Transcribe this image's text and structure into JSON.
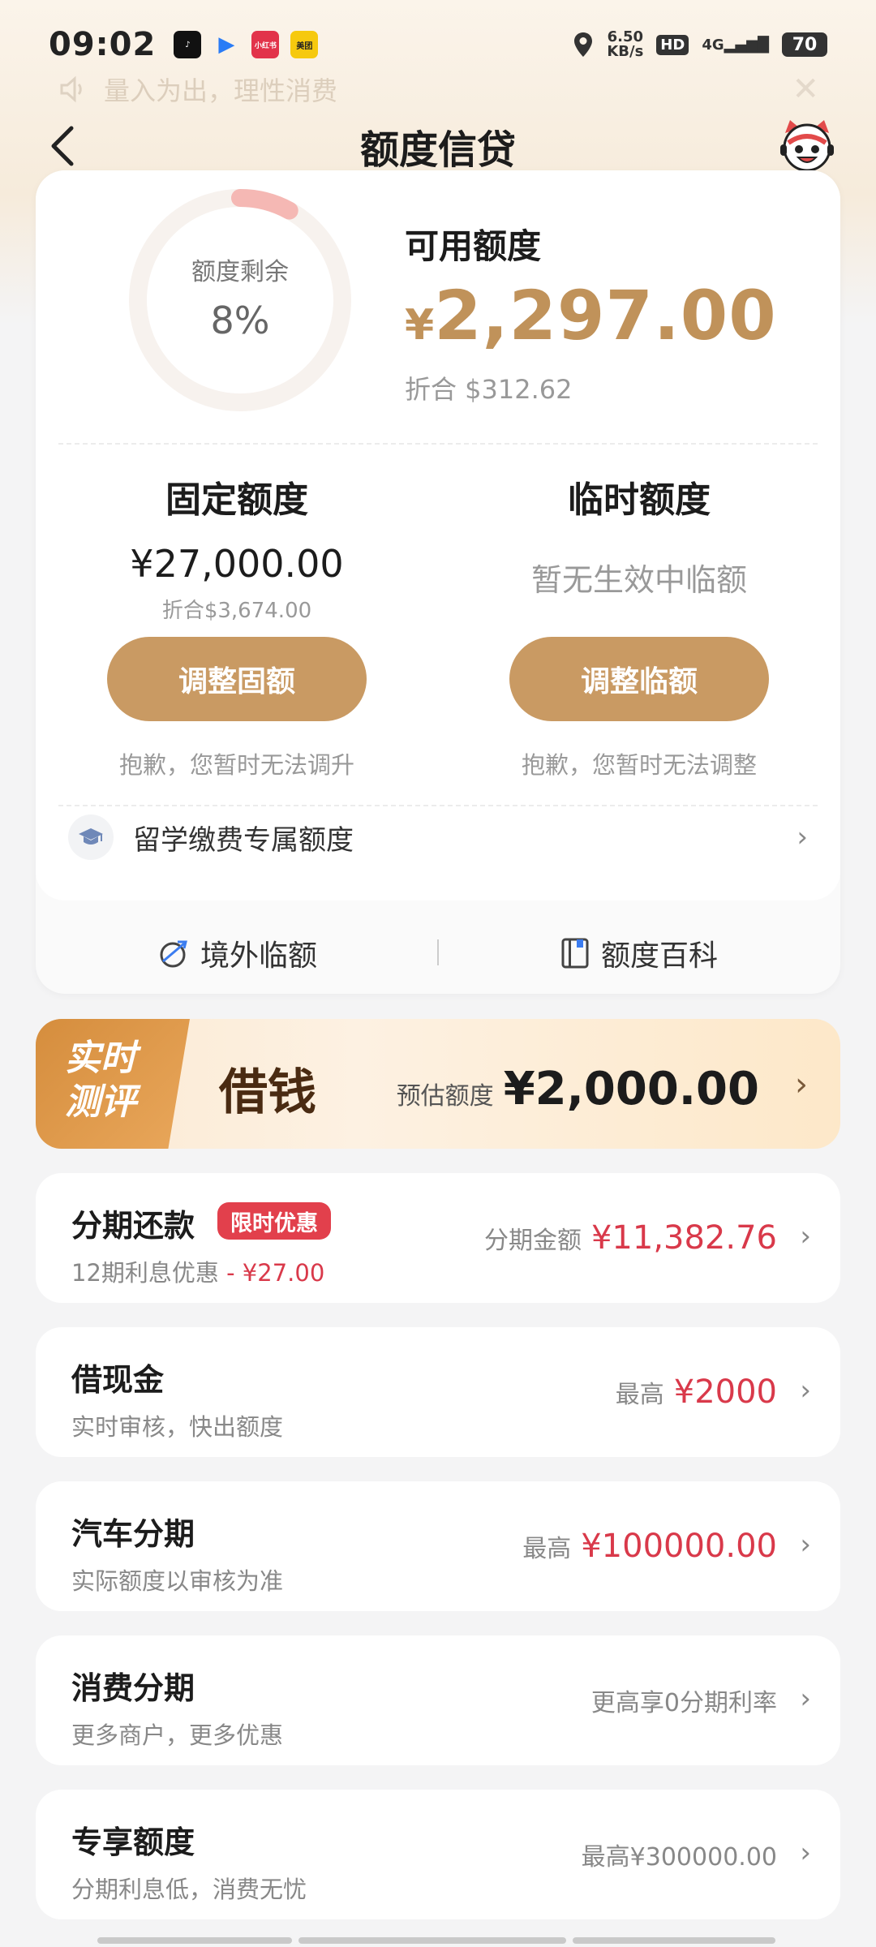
{
  "status_bar": {
    "time": "09:02",
    "apps": [
      {
        "name": "tiktok-icon",
        "text": "♪",
        "color": "#111111"
      },
      {
        "name": "video-app-icon",
        "text": "▶",
        "color": "#2a7cf6"
      },
      {
        "name": "xiaohongshu-icon",
        "text": "小红书",
        "color": "#e2334a"
      },
      {
        "name": "meituan-icon",
        "text": "美团",
        "color": "#f6c90e"
      }
    ],
    "net_speed_value": "6.50",
    "net_speed_unit": "KB/s",
    "hd": "HD",
    "signal": "4G",
    "battery": "70"
  },
  "notice": {
    "text": "量入为出，理性消费"
  },
  "header": {
    "title": "额度信贷"
  },
  "credit": {
    "ring_label": "额度剩余",
    "ring_percent_text": "8%",
    "ring_fraction": 0.08,
    "available_label": "可用额度",
    "currency_symbol": "¥",
    "available_amount": "2,297.00",
    "available_usd": "折合  $312.62",
    "fixed": {
      "title": "固定额度",
      "amount": "¥27,000.00",
      "usd": "折合$3,674.00",
      "button": "调整固额",
      "note": "抱歉，您暂时无法调升"
    },
    "temp": {
      "title": "临时额度",
      "status": "暂无生效中临额",
      "button": "调整临额",
      "note": "抱歉，您暂时无法调整"
    },
    "study": {
      "label": "留学缴费专属额度"
    },
    "links": [
      {
        "label": "境外临额",
        "icon": "plane-globe-icon"
      },
      {
        "label": "额度百科",
        "icon": "book-icon"
      }
    ]
  },
  "loan_banner": {
    "tag_line1": "实时",
    "tag_line2": "测评",
    "title": "借钱",
    "estimate_label": "预估额度",
    "estimate_amount": "¥2,000.00"
  },
  "list": [
    {
      "title": "分期还款",
      "badge": "限时优惠",
      "sub_text": "12期利息优惠",
      "sub_red": "- ¥27.00",
      "right_label": "分期金额",
      "right_amount": "¥11,382.76"
    },
    {
      "title": "借现金",
      "sub_text": "实时审核，快出额度",
      "right_label": "最高",
      "right_amount": "¥2000"
    },
    {
      "title": "汽车分期",
      "sub_text": "实际额度以审核为准",
      "right_label": "最高",
      "right_amount": "¥100000.00"
    },
    {
      "title": "消费分期",
      "sub_text": "更多商户，更多优惠",
      "right_gray": "更高享0分期利率"
    },
    {
      "title": "专享额度",
      "sub_text": "分期利息低，消费无忧",
      "right_gray": "最高¥300000.00"
    }
  ],
  "colors": {
    "accent_gold": "#c99a63",
    "amount_gold": "#c0925a",
    "price_red": "#d9394a",
    "ring_arc": "#f5b8b4",
    "ring_track": "#f7f2ee"
  }
}
